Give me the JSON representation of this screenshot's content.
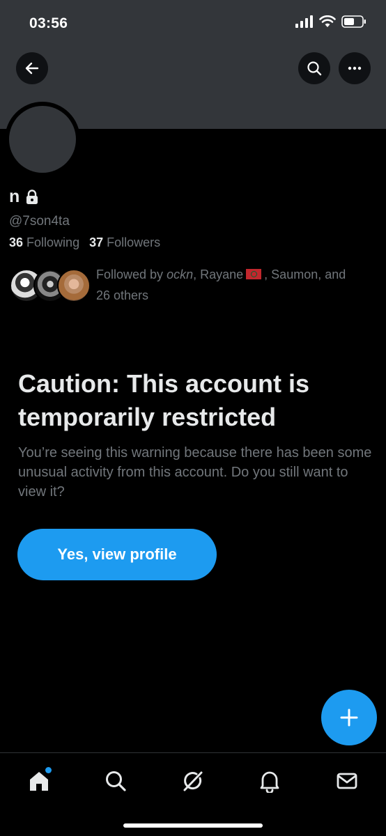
{
  "status_bar": {
    "time": "03:56"
  },
  "profile": {
    "display_name": "n",
    "handle": "@7son4ta",
    "following_count": "36",
    "following_label": "Following",
    "followers_count": "37",
    "followers_label": "Followers"
  },
  "followed_by": {
    "prefix": "Followed by",
    "user1": "ockn",
    "sep1": ",",
    "user2": "Rayane",
    "rest": ", Saumon, and",
    "others": "26 others"
  },
  "warning": {
    "title": "Caution: This account is temporarily restricted",
    "body": "You’re seeing this warning because there has been some unusual activity from this account. Do you still want to view it?",
    "button_label": "Yes, view profile"
  },
  "colors": {
    "accent": "#1d9bf0",
    "banner": "#33363a",
    "muted_text": "#71767b"
  },
  "icons": {
    "back": "arrow-left-icon",
    "search": "search-icon",
    "more": "more-horizontal-icon",
    "locked": "lock-icon",
    "compose": "plus-icon",
    "tabs": [
      "home-icon",
      "search-icon",
      "grok-icon",
      "bell-icon",
      "mail-icon"
    ]
  }
}
